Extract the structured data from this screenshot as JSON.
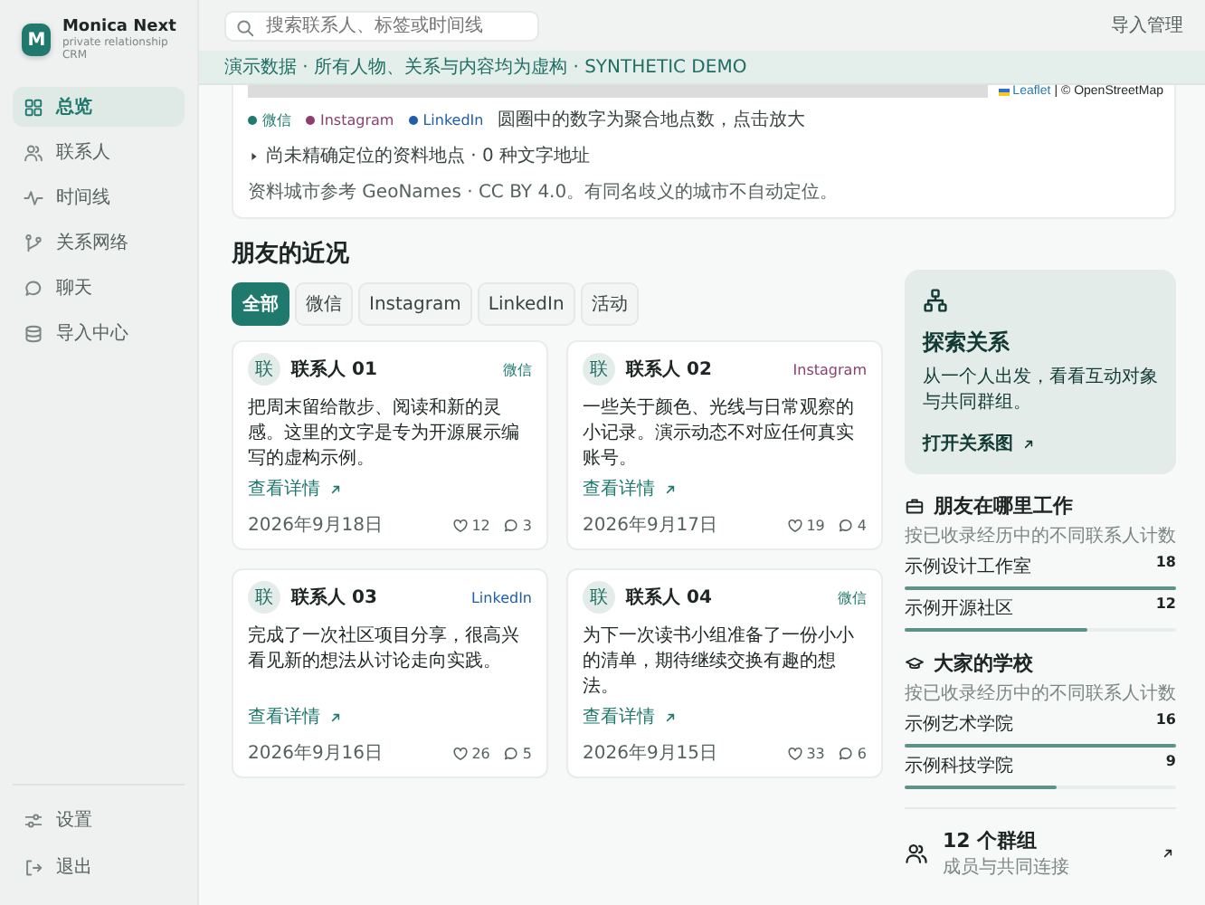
{
  "app": {
    "logo": "M",
    "name": "Monica Next",
    "subtitle": "private relationship CRM"
  },
  "nav": [
    {
      "label": "总览",
      "kind": "grid",
      "selected": true
    },
    {
      "label": "联系人",
      "kind": "people",
      "selected": false
    },
    {
      "label": "时间线",
      "kind": "pulse",
      "selected": false
    },
    {
      "label": "关系网络",
      "kind": "branch",
      "selected": false
    },
    {
      "label": "聊天",
      "kind": "chat",
      "selected": false
    },
    {
      "label": "导入中心",
      "kind": "database",
      "selected": false
    }
  ],
  "footer_nav": [
    {
      "label": "设置",
      "kind": "sliders"
    },
    {
      "label": "退出",
      "kind": "logout"
    }
  ],
  "search": {
    "placeholder": "搜索联系人、标签或时间线"
  },
  "header_link": "导入管理",
  "banner": "演示数据 · 所有人物、关系与内容均为虚构 · SYNTHETIC DEMO",
  "map": {
    "attribution_link": "Leaflet",
    "attribution": "| © OpenStreetMap",
    "legend": [
      {
        "label": "微信",
        "color": "#1f7a6d"
      },
      {
        "label": "Instagram",
        "color": "#8a3f6f"
      },
      {
        "label": "LinkedIn",
        "color": "#1f5ea8"
      }
    ],
    "legend_note": "圆圈中的数字为聚合地点数，点击放大",
    "unlocated": {
      "label": "尚未精确定位的资料地点 · 0 种文字地址",
      "expanded": false
    },
    "source": "资料城市参考 GeoNames · CC BY 4.0。有同名歧义的城市不自动定位。"
  },
  "feed": {
    "title": "朋友的近况",
    "filters": [
      {
        "label": "全部",
        "selected": true
      },
      {
        "label": "微信",
        "selected": false
      },
      {
        "label": "Instagram",
        "selected": false
      },
      {
        "label": "LinkedIn",
        "selected": false
      },
      {
        "label": "活动",
        "selected": false
      }
    ],
    "posts": [
      {
        "avatar": "联",
        "name": "联系人 01",
        "platform": "微信",
        "color": "#1f7a6d",
        "text": "把周末留给散步、阅读和新的灵感。这里的文字是专为开源展示编写的虚构示例。",
        "link": "查看详情",
        "date": "2026年9月18日",
        "likes": "12",
        "comments": "3"
      },
      {
        "avatar": "联",
        "name": "联系人 02",
        "platform": "Instagram",
        "color": "#8a3f6f",
        "text": "一些关于颜色、光线与日常观察的小记录。演示动态不对应任何真实账号。",
        "link": "查看详情",
        "date": "2026年9月17日",
        "likes": "19",
        "comments": "4"
      },
      {
        "avatar": "联",
        "name": "联系人 03",
        "platform": "LinkedIn",
        "color": "#1f5ea8",
        "text": "完成了一次社区项目分享，很高兴看见新的想法从讨论走向实践。",
        "link": "查看详情",
        "date": "2026年9月16日",
        "likes": "26",
        "comments": "5"
      },
      {
        "avatar": "联",
        "name": "联系人 04",
        "platform": "微信",
        "color": "#1f7a6d",
        "text": "为下一次读书小组准备了一份小小的清单，期待继续交换有趣的想法。",
        "link": "查看详情",
        "date": "2026年9月15日",
        "likes": "33",
        "comments": "6"
      }
    ]
  },
  "explore": {
    "title": "探索关系",
    "text": "从一个人出发，看看互动对象与共同群组。",
    "link": "打开关系图"
  },
  "stats": [
    {
      "kind": "work",
      "title": "朋友在哪里工作",
      "subtitle": "按已收录经历中的不同联系人计数",
      "items": [
        {
          "name": "示例设计工作室",
          "count": "18",
          "level": 1
        },
        {
          "name": "示例开源社区",
          "count": "12",
          "level": 0.67
        }
      ]
    },
    {
      "kind": "school",
      "title": "大家的学校",
      "subtitle": "按已收录经历中的不同联系人计数",
      "items": [
        {
          "name": "示例艺术学院",
          "count": "16",
          "level": 1
        },
        {
          "name": "示例科技学院",
          "count": "9",
          "level": 0.56
        }
      ]
    }
  ],
  "groups": {
    "title": "12 个群组",
    "subtitle": "成员与共同连接"
  }
}
